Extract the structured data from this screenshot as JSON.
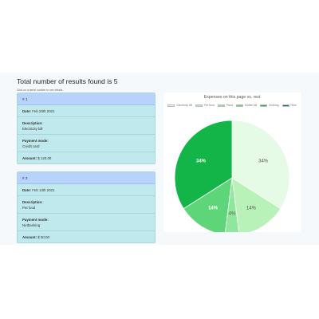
{
  "results": {
    "heading": "Total number of results found is 5",
    "hint": "Click on a serial number to see details."
  },
  "cards": [
    {
      "serial": "# 1",
      "date_label": "Date:",
      "date": "Feb 20th 2021",
      "description_label": "Description:",
      "description": "Electricity bill",
      "payment_label": "Payment mode:",
      "payment": "Credit card",
      "amount_label": "Amount:",
      "amount": "$ 120.00"
    },
    {
      "serial": "# 3",
      "date_label": "Date:",
      "date": "Feb 13th 2021",
      "description_label": "Description:",
      "description": "Pet food",
      "payment_label": "Payment mode:",
      "payment": "Netbanking",
      "amount_label": "Amount:",
      "amount": "$ 50.00"
    }
  ],
  "chart_data": {
    "type": "pie",
    "title": "Expenses on this page vs. rest",
    "categories": [
      "Electricity bill",
      "Pet food",
      "Pizza",
      "Mobile bill",
      "Clothing",
      "Rest"
    ],
    "values": [
      34,
      14,
      4,
      14,
      34,
      0
    ],
    "value_labels": [
      "34%",
      "14%",
      "4%",
      "14%",
      "34%",
      ""
    ],
    "colors": [
      "#e6fbe6",
      "#b8f2b8",
      "#8ee89c",
      "#5fd57a",
      "#13b549",
      "#0a7a30"
    ],
    "legend_position": "top"
  }
}
